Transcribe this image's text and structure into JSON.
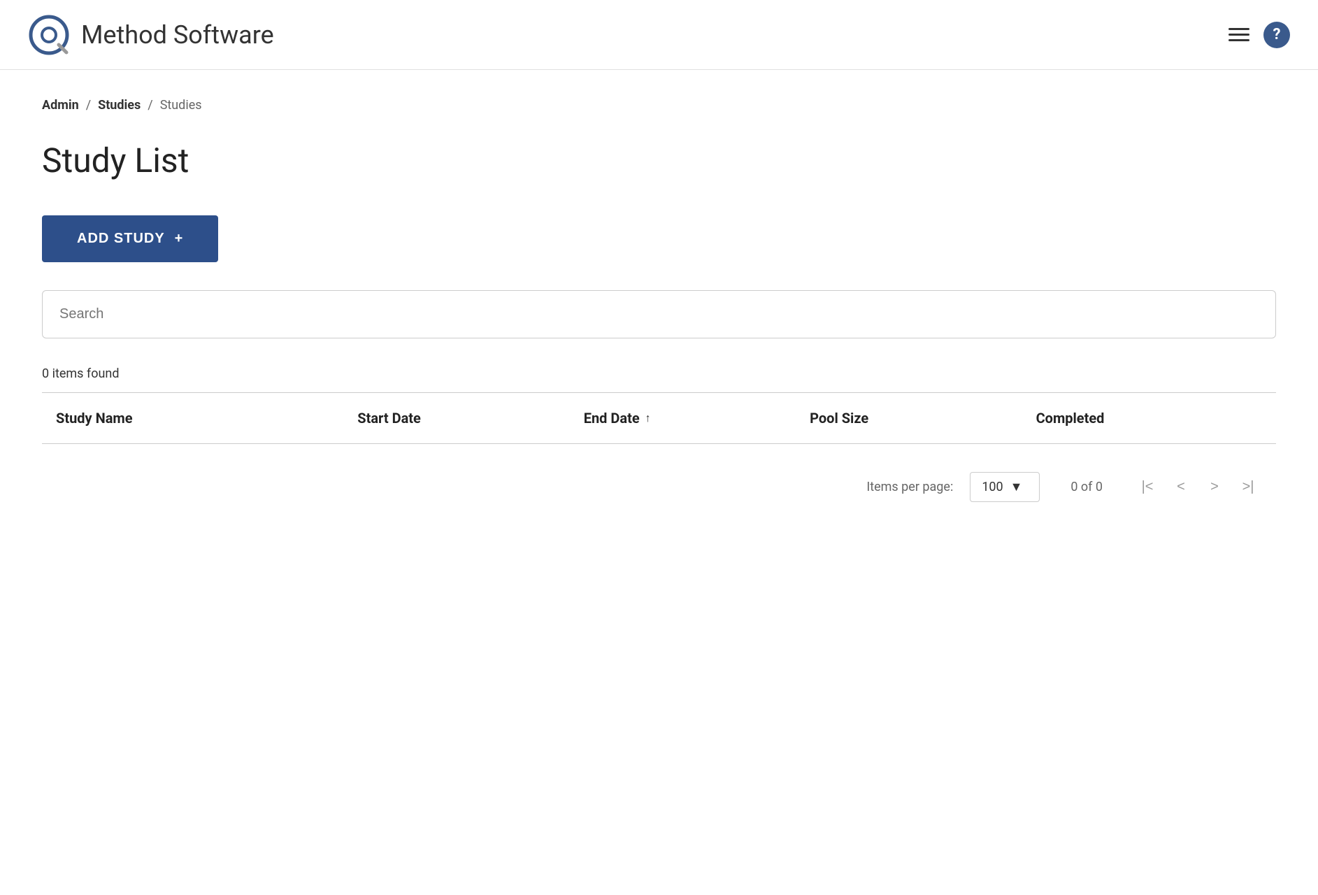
{
  "app": {
    "title": "Method Software"
  },
  "header": {
    "menu_icon_label": "menu",
    "help_icon_label": "?"
  },
  "breadcrumb": {
    "items": [
      {
        "label": "Admin",
        "active": false
      },
      {
        "label": "Studies",
        "active": false
      },
      {
        "label": "Studies",
        "active": true
      }
    ]
  },
  "page": {
    "title": "Study List"
  },
  "buttons": {
    "add_study": "ADD STUDY",
    "add_study_icon": "+"
  },
  "search": {
    "placeholder": "Search"
  },
  "table": {
    "items_found": "0 items found",
    "columns": [
      {
        "label": "Study Name",
        "sortable": false,
        "sort_arrow": ""
      },
      {
        "label": "Start Date",
        "sortable": false,
        "sort_arrow": ""
      },
      {
        "label": "End Date",
        "sortable": true,
        "sort_arrow": "↑"
      },
      {
        "label": "Pool Size",
        "sortable": false,
        "sort_arrow": ""
      },
      {
        "label": "Completed",
        "sortable": false,
        "sort_arrow": ""
      }
    ]
  },
  "pagination": {
    "items_per_page_label": "Items per page:",
    "items_per_page_value": "100",
    "items_per_page_arrow": "▼",
    "page_info": "0 of 0",
    "first_page_icon": "|<",
    "prev_page_icon": "<",
    "next_page_icon": ">",
    "last_page_icon": ">|"
  }
}
